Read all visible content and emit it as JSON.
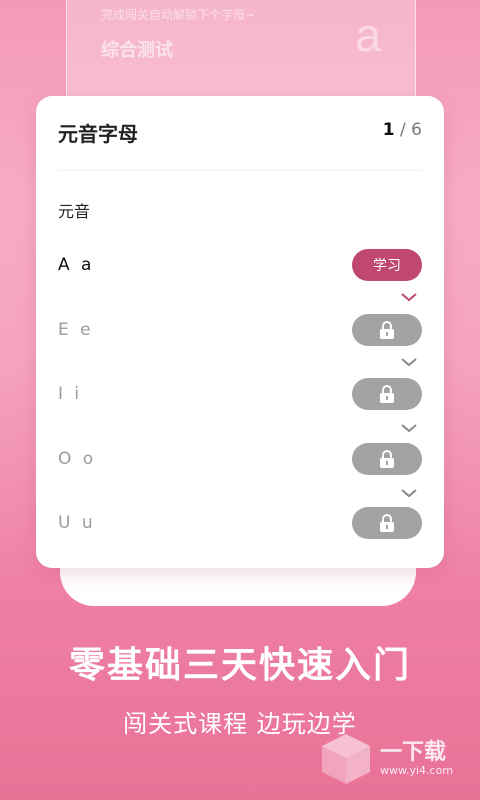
{
  "background_card": {
    "hint": "完成闯关自动解锁下个字母~",
    "title": "综合测试",
    "letter": "a"
  },
  "card": {
    "title": "元音字母",
    "pager": {
      "current": "1",
      "separator": "/",
      "total": "6"
    },
    "section_label": "元音",
    "items": [
      {
        "label": "A a",
        "state": "active",
        "action_label": "学习"
      },
      {
        "label": "E e",
        "state": "locked",
        "icon": "lock-icon"
      },
      {
        "label": "I i",
        "state": "locked",
        "icon": "lock-icon"
      },
      {
        "label": "O o",
        "state": "locked",
        "icon": "lock-icon"
      },
      {
        "label": "U u",
        "state": "locked",
        "icon": "lock-icon"
      }
    ]
  },
  "promo": {
    "headline": "零基础三天快速入门",
    "subline": "闯关式课程 边玩边学"
  },
  "watermark": {
    "name": "一下载",
    "url": "www.yi4.com"
  },
  "colors": {
    "accent": "#c0486f",
    "locked": "#a3a3a3",
    "background_top": "#f39ab8",
    "background_bottom": "#e97297"
  }
}
